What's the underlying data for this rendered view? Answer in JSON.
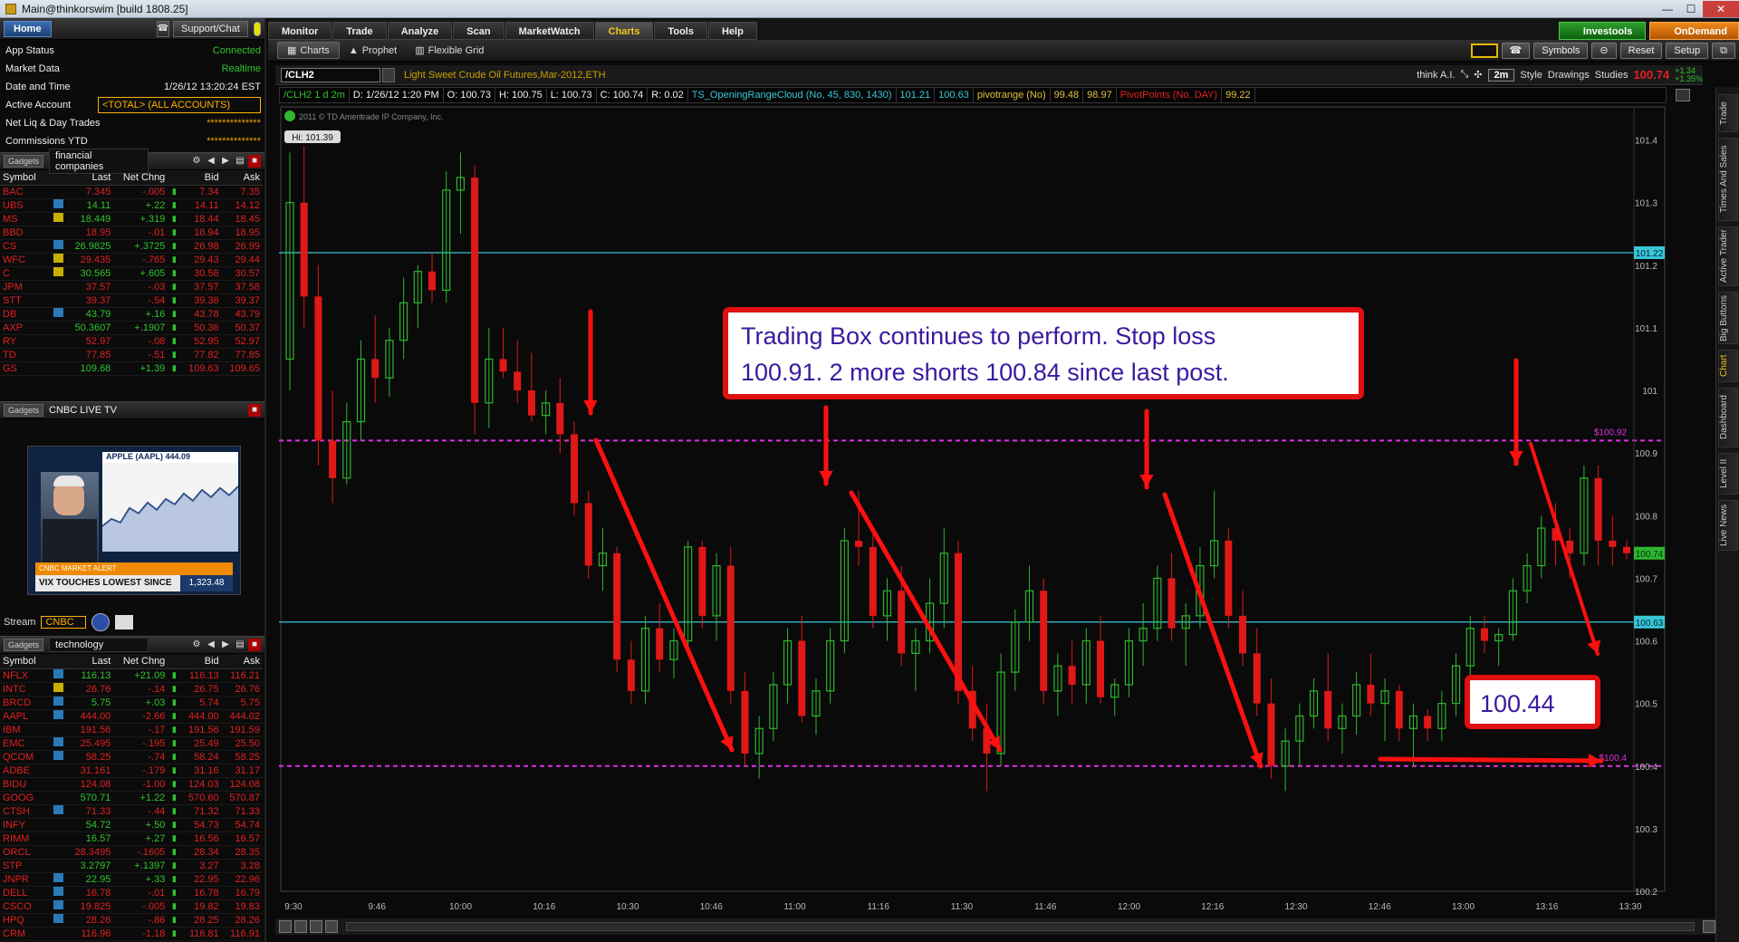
{
  "window": {
    "title": "Main@thinkorswim [build 1808.25]"
  },
  "left": {
    "home_label": "Home",
    "support_label": "Support/Chat",
    "account": [
      {
        "k": "App Status",
        "v": "Connected",
        "cls": "green"
      },
      {
        "k": "Market Data",
        "v": "Realtime",
        "cls": "green"
      },
      {
        "k": "Date and Time",
        "v": "1/26/12 13:20:24 EST",
        "cls": "white"
      },
      {
        "k": "Active Account",
        "v": "<TOTAL> (ALL ACCOUNTS)",
        "cls": "sel"
      },
      {
        "k": "Net Liq & Day Trades",
        "v": "**************",
        "cls": ""
      },
      {
        "k": "Commissions YTD",
        "v": "**************",
        "cls": ""
      }
    ],
    "gadget_badge": "Gadgets",
    "watch1": {
      "name": "financial companies",
      "headers": [
        "Symbol",
        "Last",
        "Net Chng",
        "Bid",
        "Ask"
      ],
      "rows": [
        [
          "BAC",
          "",
          "7.345",
          "-.005",
          "7.34",
          "7.35"
        ],
        [
          "UBS",
          "b",
          "14.11",
          "+.22",
          "14.11",
          "14.12"
        ],
        [
          "MS",
          "y",
          "18.449",
          "+.319",
          "18.44",
          "18.45"
        ],
        [
          "BBD",
          "",
          "18.95",
          "-.01",
          "18.94",
          "18.95"
        ],
        [
          "CS",
          "b",
          "26.9825",
          "+.3725",
          "26.98",
          "26.99"
        ],
        [
          "WFC",
          "y",
          "29.435",
          "-.765",
          "29.43",
          "29.44"
        ],
        [
          "C",
          "y",
          "30.565",
          "+.605",
          "30.56",
          "30.57"
        ],
        [
          "JPM",
          "",
          "37.57",
          "-.03",
          "37.57",
          "37.58"
        ],
        [
          "STT",
          "",
          "39.37",
          "-.54",
          "39.36",
          "39.37"
        ],
        [
          "DB",
          "b",
          "43.79",
          "+.16",
          "43.78",
          "43.79"
        ],
        [
          "AXP",
          "",
          "50.3607",
          "+.1907",
          "50.36",
          "50.37"
        ],
        [
          "RY",
          "",
          "52.97",
          "-.08",
          "52.95",
          "52.97"
        ],
        [
          "TD",
          "",
          "77.85",
          "-.51",
          "77.82",
          "77.85"
        ],
        [
          "GS",
          "",
          "109.68",
          "+1.39",
          "109.63",
          "109.65"
        ]
      ]
    },
    "tv": {
      "gadget_name": "CNBC LIVE TV",
      "ticker": "APPLE (AAPL)",
      "price": "444.09",
      "alert": "CNBC MARKET ALERT",
      "headline": "VIX TOUCHES LOWEST SINCE JULY",
      "spx": "1,323.48",
      "stream_label": "Stream",
      "stream_value": "CNBC"
    },
    "watch2": {
      "name": "technology",
      "headers": [
        "Symbol",
        "Last",
        "Net Chng",
        "Bid",
        "Ask"
      ],
      "rows": [
        [
          "NFLX",
          "b",
          "116.13",
          "+21.09",
          "116.13",
          "116.21"
        ],
        [
          "INTC",
          "y",
          "26.76",
          "-.14",
          "26.75",
          "26.76"
        ],
        [
          "BRCD",
          "b",
          "5.75",
          "+.03",
          "5.74",
          "5.75"
        ],
        [
          "AAPL",
          "b",
          "444.00",
          "-2.66",
          "444.00",
          "444.02"
        ],
        [
          "IBM",
          "",
          "191.56",
          "-.17",
          "191.56",
          "191.59"
        ],
        [
          "EMC",
          "b",
          "25.495",
          "-.195",
          "25.49",
          "25.50"
        ],
        [
          "QCOM",
          "b",
          "58.25",
          "-.74",
          "58.24",
          "58.25"
        ],
        [
          "ADBE",
          "",
          "31.161",
          "-.179",
          "31.16",
          "31.17"
        ],
        [
          "BIDU",
          "",
          "124.08",
          "-1.00",
          "124.03",
          "124.08"
        ],
        [
          "GOOG",
          "",
          "570.71",
          "+1.22",
          "570.60",
          "570.87"
        ],
        [
          "CTSH",
          "b",
          "71.33",
          "-.44",
          "71.32",
          "71.33"
        ],
        [
          "INFY",
          "",
          "54.72",
          "+.50",
          "54.73",
          "54.74"
        ],
        [
          "RIMM",
          "",
          "16.57",
          "+.27",
          "16.56",
          "16.57"
        ],
        [
          "ORCL",
          "",
          "28.3495",
          "-.1605",
          "28.34",
          "28.35"
        ],
        [
          "STP",
          "",
          "3.2797",
          "+.1397",
          "3.27",
          "3.28"
        ],
        [
          "JNPR",
          "b",
          "22.95",
          "+.33",
          "22.95",
          "22.96"
        ],
        [
          "DELL",
          "b",
          "16.78",
          "-.01",
          "16.78",
          "16.79"
        ],
        [
          "CSCO",
          "b",
          "19.825",
          "-.005",
          "19.82",
          "19.83"
        ],
        [
          "HPQ",
          "b",
          "28.26",
          "-.86",
          "28.25",
          "28.26"
        ],
        [
          "CRM",
          "",
          "116.96",
          "-1.18",
          "116.81",
          "116.91"
        ]
      ]
    }
  },
  "nav": {
    "tabs": [
      "Monitor",
      "Trade",
      "Analyze",
      "Scan",
      "MarketWatch",
      "Charts",
      "Tools",
      "Help"
    ],
    "active": "Charts",
    "investools": "Investools",
    "ondemand": "OnDemand"
  },
  "subnav": {
    "tabs": [
      "Charts",
      "Prophet",
      "Flexible Grid"
    ],
    "buttons": [
      "Symbols",
      "Reset",
      "Setup"
    ]
  },
  "symbol_bar": {
    "symbol": "/CLH2",
    "description": "Light Sweet Crude Oil Futures,Mar-2012,ETH",
    "think_ai": "think A.I.",
    "aggregation": "2m",
    "style": "Style",
    "drawings": "Drawings",
    "studies": "Studies",
    "last": "100.74",
    "chg_top": "+1.34",
    "chg_bot": "+1.35%"
  },
  "study_bar": {
    "label": "/CLH2 1 d 2m",
    "d": "D: 1/26/12 1:20 PM",
    "o": "O: 100.73",
    "h": "H: 100.75",
    "l": "L: 100.73",
    "c": "C: 100.74",
    "r": "R: 0.02",
    "orc": "TS_OpeningRangeCloud (No, 45, 830, 1430)",
    "orc_hi": "101.21",
    "orc_lo": "100.63",
    "pivot": "pivotrange (No)",
    "pivot_hi": "99.48",
    "pivot_lo": "98.97",
    "pp": "PivotPoints (No, DAY)",
    "pp_val": "99.22"
  },
  "chart_data": {
    "type": "candlestick",
    "copyright": "2011 © TD Ameritrade IP Company, Inc.",
    "hi_label": "Hi: 101.39",
    "ylim": [
      100.2,
      101.45
    ],
    "yticks": [
      "101.4",
      "101.3",
      "101.2",
      "101.1",
      "101",
      "100.9",
      "100.8",
      "100.7",
      "100.6",
      "100.5",
      "100.4",
      "100.3",
      "100.2"
    ],
    "xticks": [
      "9:30",
      "9:46",
      "10:00",
      "10:16",
      "10:30",
      "10:46",
      "11:00",
      "11:16",
      "11:30",
      "11:46",
      "12:00",
      "12:16",
      "12:30",
      "12:46",
      "13:00",
      "13:16",
      "13:30"
    ],
    "levels": [
      {
        "value": 101.22,
        "kind": "cyan",
        "label": "101.22"
      },
      {
        "value": 100.63,
        "kind": "cyan",
        "label": "100.63"
      },
      {
        "value": 100.92,
        "kind": "magenta",
        "label": "$100.92"
      },
      {
        "value": 100.4,
        "kind": "magenta",
        "label": "$100.4"
      }
    ],
    "last_price": 100.74,
    "last_label": "100.74",
    "candles": [
      [
        101.05,
        101.38,
        101.0,
        101.3
      ],
      [
        101.3,
        101.39,
        101.1,
        101.15
      ],
      [
        101.15,
        101.2,
        100.88,
        100.92
      ],
      [
        100.92,
        101.0,
        100.82,
        100.86
      ],
      [
        100.86,
        100.98,
        100.85,
        100.95
      ],
      [
        100.95,
        101.08,
        100.92,
        101.05
      ],
      [
        101.05,
        101.12,
        100.98,
        101.02
      ],
      [
        101.02,
        101.1,
        100.99,
        101.08
      ],
      [
        101.08,
        101.18,
        101.05,
        101.14
      ],
      [
        101.14,
        101.2,
        101.1,
        101.19
      ],
      [
        101.19,
        101.22,
        101.14,
        101.16
      ],
      [
        101.16,
        101.35,
        101.14,
        101.32
      ],
      [
        101.32,
        101.38,
        101.25,
        101.34
      ],
      [
        101.34,
        101.36,
        100.93,
        100.98
      ],
      [
        100.98,
        101.1,
        100.94,
        101.05
      ],
      [
        101.05,
        101.1,
        101.02,
        101.03
      ],
      [
        101.03,
        101.08,
        100.98,
        101.0
      ],
      [
        101.0,
        101.06,
        100.95,
        100.96
      ],
      [
        100.96,
        101.0,
        100.93,
        100.98
      ],
      [
        100.98,
        101.02,
        100.9,
        100.93
      ],
      [
        100.93,
        100.95,
        100.8,
        100.82
      ],
      [
        100.82,
        100.84,
        100.7,
        100.72
      ],
      [
        100.72,
        100.78,
        100.68,
        100.74
      ],
      [
        100.74,
        100.75,
        100.55,
        100.57
      ],
      [
        100.57,
        100.6,
        100.5,
        100.52
      ],
      [
        100.52,
        100.64,
        100.5,
        100.62
      ],
      [
        100.62,
        100.66,
        100.55,
        100.57
      ],
      [
        100.57,
        100.62,
        100.54,
        100.6
      ],
      [
        100.6,
        100.76,
        100.58,
        100.75
      ],
      [
        100.75,
        100.76,
        100.62,
        100.64
      ],
      [
        100.64,
        100.74,
        100.6,
        100.72
      ],
      [
        100.72,
        100.75,
        100.5,
        100.52
      ],
      [
        100.52,
        100.55,
        100.4,
        100.42
      ],
      [
        100.42,
        100.48,
        100.38,
        100.46
      ],
      [
        100.46,
        100.55,
        100.44,
        100.53
      ],
      [
        100.53,
        100.62,
        100.5,
        100.6
      ],
      [
        100.6,
        100.64,
        100.47,
        100.48
      ],
      [
        100.48,
        100.54,
        100.45,
        100.52
      ],
      [
        100.52,
        100.62,
        100.5,
        100.6
      ],
      [
        100.6,
        100.78,
        100.58,
        100.76
      ],
      [
        100.76,
        100.84,
        100.72,
        100.75
      ],
      [
        100.75,
        100.78,
        100.62,
        100.64
      ],
      [
        100.64,
        100.7,
        100.6,
        100.68
      ],
      [
        100.68,
        100.72,
        100.56,
        100.58
      ],
      [
        100.58,
        100.62,
        100.52,
        100.6
      ],
      [
        100.6,
        100.7,
        100.58,
        100.66
      ],
      [
        100.66,
        100.78,
        100.62,
        100.74
      ],
      [
        100.74,
        100.76,
        100.5,
        100.52
      ],
      [
        100.52,
        100.56,
        100.44,
        100.46
      ],
      [
        100.46,
        100.5,
        100.36,
        100.42
      ],
      [
        100.42,
        100.58,
        100.4,
        100.55
      ],
      [
        100.55,
        100.65,
        100.52,
        100.63
      ],
      [
        100.63,
        100.72,
        100.6,
        100.68
      ],
      [
        100.68,
        100.7,
        100.5,
        100.52
      ],
      [
        100.52,
        100.58,
        100.48,
        100.56
      ],
      [
        100.56,
        100.6,
        100.5,
        100.53
      ],
      [
        100.53,
        100.62,
        100.5,
        100.6
      ],
      [
        100.6,
        100.64,
        100.5,
        100.51
      ],
      [
        100.51,
        100.54,
        100.48,
        100.53
      ],
      [
        100.53,
        100.62,
        100.51,
        100.6
      ],
      [
        100.6,
        100.66,
        100.56,
        100.62
      ],
      [
        100.62,
        100.72,
        100.6,
        100.7
      ],
      [
        100.7,
        100.74,
        100.6,
        100.62
      ],
      [
        100.62,
        100.66,
        100.56,
        100.64
      ],
      [
        100.64,
        100.75,
        100.62,
        100.72
      ],
      [
        100.72,
        100.84,
        100.7,
        100.76
      ],
      [
        100.76,
        100.78,
        100.62,
        100.64
      ],
      [
        100.64,
        100.68,
        100.56,
        100.58
      ],
      [
        100.58,
        100.62,
        100.48,
        100.5
      ],
      [
        100.5,
        100.54,
        100.38,
        100.4
      ],
      [
        100.4,
        100.46,
        100.36,
        100.44
      ],
      [
        100.44,
        100.5,
        100.4,
        100.48
      ],
      [
        100.48,
        100.54,
        100.46,
        100.52
      ],
      [
        100.52,
        100.58,
        100.44,
        100.46
      ],
      [
        100.46,
        100.5,
        100.42,
        100.48
      ],
      [
        100.48,
        100.55,
        100.45,
        100.53
      ],
      [
        100.53,
        100.58,
        100.48,
        100.5
      ],
      [
        100.5,
        100.54,
        100.44,
        100.52
      ],
      [
        100.52,
        100.53,
        100.44,
        100.46
      ],
      [
        100.46,
        100.5,
        100.4,
        100.48
      ],
      [
        100.48,
        100.49,
        100.44,
        100.46
      ],
      [
        100.46,
        100.52,
        100.44,
        100.5
      ],
      [
        100.5,
        100.58,
        100.48,
        100.56
      ],
      [
        100.56,
        100.64,
        100.54,
        100.62
      ],
      [
        100.62,
        100.64,
        100.58,
        100.6
      ],
      [
        100.6,
        100.62,
        100.56,
        100.61
      ],
      [
        100.61,
        100.7,
        100.6,
        100.68
      ],
      [
        100.68,
        100.74,
        100.66,
        100.72
      ],
      [
        100.72,
        100.8,
        100.7,
        100.78
      ],
      [
        100.78,
        100.82,
        100.72,
        100.76
      ],
      [
        100.76,
        100.78,
        100.7,
        100.74
      ],
      [
        100.74,
        100.88,
        100.72,
        100.86
      ],
      [
        100.86,
        100.88,
        100.72,
        100.76
      ],
      [
        100.76,
        100.8,
        100.72,
        100.75
      ],
      [
        100.75,
        100.76,
        100.73,
        100.74
      ]
    ]
  },
  "annotations": {
    "box1": "Trading Box continues to perform. Stop loss 100.91. 2 more shorts 100.84 since last post.",
    "box2": "100.44"
  },
  "vtabs": [
    "Trade",
    "Times And Sales",
    "Active Trader",
    "Big Buttons",
    "Chart",
    "Dashboard",
    "Level II",
    "Live News"
  ],
  "vtab_active": "Chart"
}
